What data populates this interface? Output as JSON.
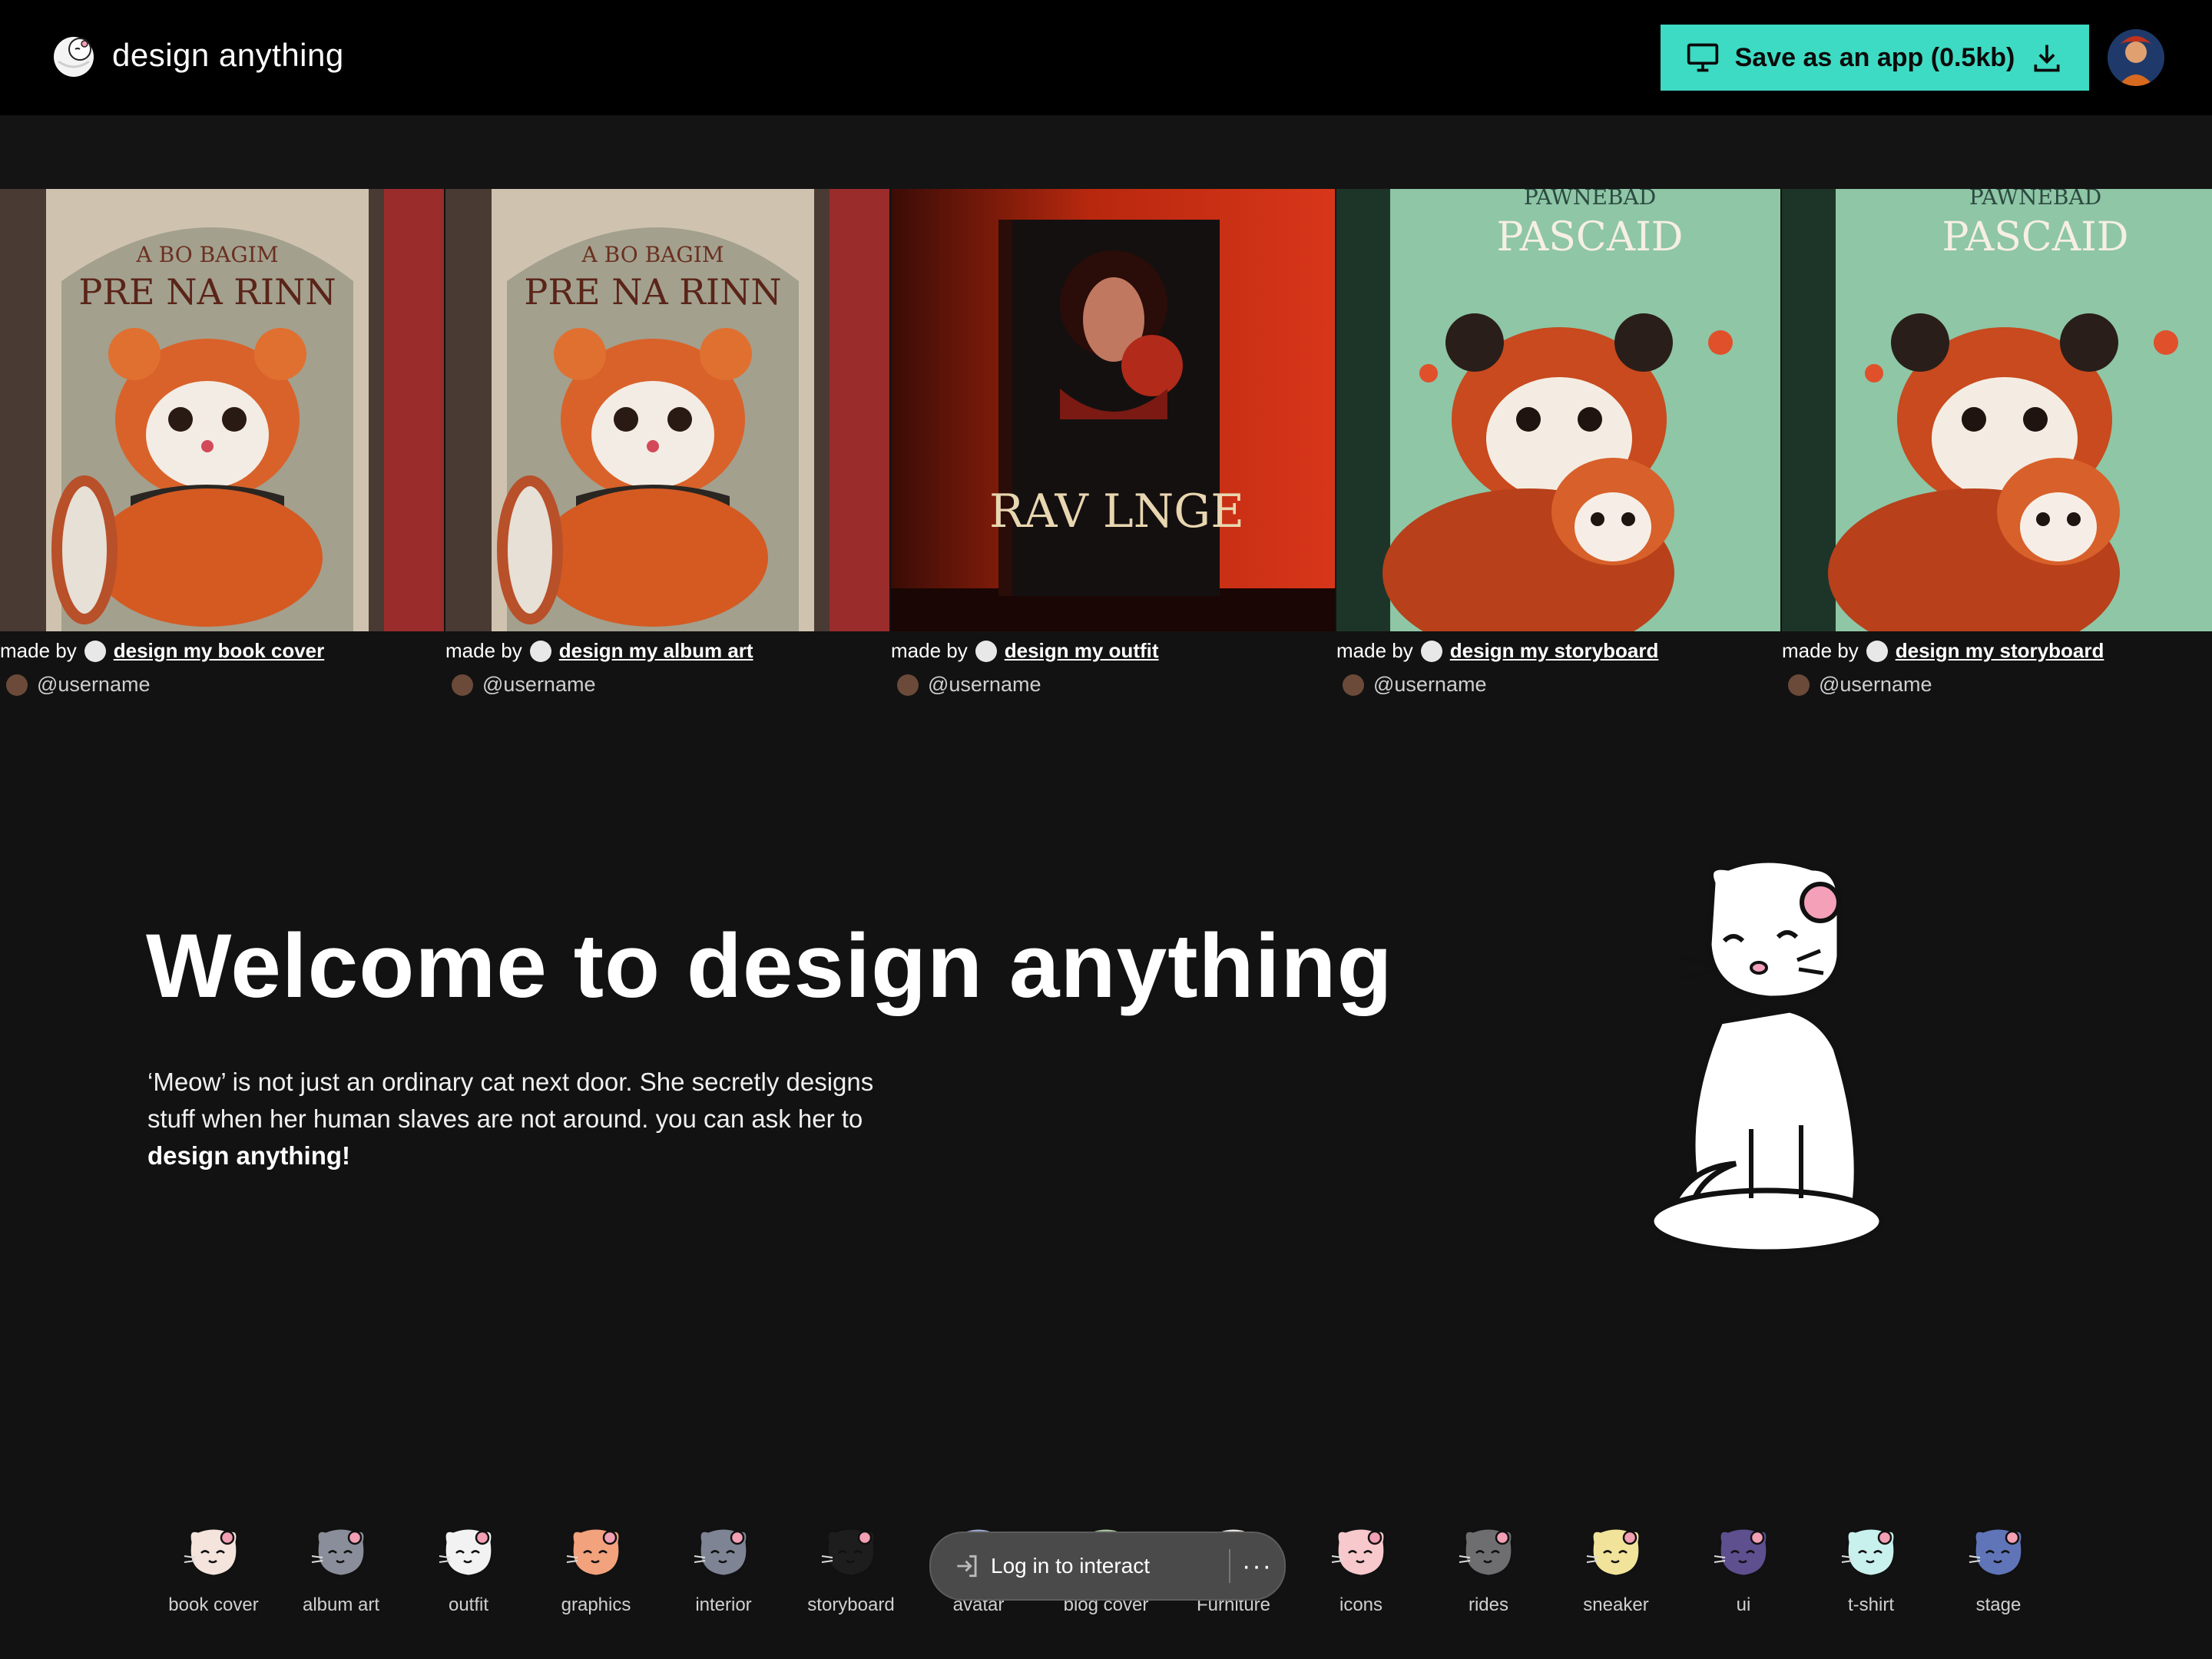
{
  "header": {
    "brand_name": "design anything",
    "save_button_label": "Save as an app (0.5kb)",
    "accent_color": "#3ddbc3"
  },
  "gallery": {
    "items": [
      {
        "made_by": "made by",
        "app": "design my book cover",
        "user": "@username",
        "cover_text_1": "A BO BAGIM",
        "cover_text_2": "PRE NA RINN"
      },
      {
        "made_by": "made by",
        "app": "design my album art",
        "user": "@username",
        "cover_text_1": "A BO BAGIM",
        "cover_text_2": "PRE NA RINN"
      },
      {
        "made_by": "made by",
        "app": "design my outfit",
        "user": "@username",
        "cover_text_1": "RAV LNGE",
        "cover_text_2": ""
      },
      {
        "made_by": "made by",
        "app": "design my storyboard",
        "user": "@username",
        "cover_text_1": "PAWNEBAD",
        "cover_text_2": "PASCAID"
      },
      {
        "made_by": "made by",
        "app": "design my storyboard",
        "user": "@username",
        "cover_text_1": "PAWNEBAD",
        "cover_text_2": "PASCAID"
      }
    ]
  },
  "hero": {
    "title": "Welcome to design anything",
    "text_before": "‘Meow’ is not just an ordinary cat next door. She secretly designs stuff when her human slaves are not around. you can ask her to ",
    "text_bold": "design anything!"
  },
  "categories": [
    {
      "label": "book cover",
      "color": "#f4e4dc"
    },
    {
      "label": "album art",
      "color": "#8a8e9a"
    },
    {
      "label": "outfit",
      "color": "#f2f2f2"
    },
    {
      "label": "graphics",
      "color": "#f2a27c"
    },
    {
      "label": "interior",
      "color": "#7e8494"
    },
    {
      "label": "storyboard",
      "color": "#1d1d1d"
    },
    {
      "label": "avatar",
      "color": "#9aa4c8"
    },
    {
      "label": "blog cover",
      "color": "#a8c2a0"
    },
    {
      "label": "Furniture",
      "color": "#e9e4e0"
    },
    {
      "label": "icons",
      "color": "#f7c8cc"
    },
    {
      "label": "rides",
      "color": "#6e6e70"
    },
    {
      "label": "sneaker",
      "color": "#f1e39a"
    },
    {
      "label": "ui",
      "color": "#5e4f8f"
    },
    {
      "label": "t-shirt",
      "color": "#c8f1ee"
    },
    {
      "label": "stage",
      "color": "#5f75b8"
    }
  ],
  "login_overlay": {
    "login_label": "Log in to interact",
    "more_label": "···"
  }
}
